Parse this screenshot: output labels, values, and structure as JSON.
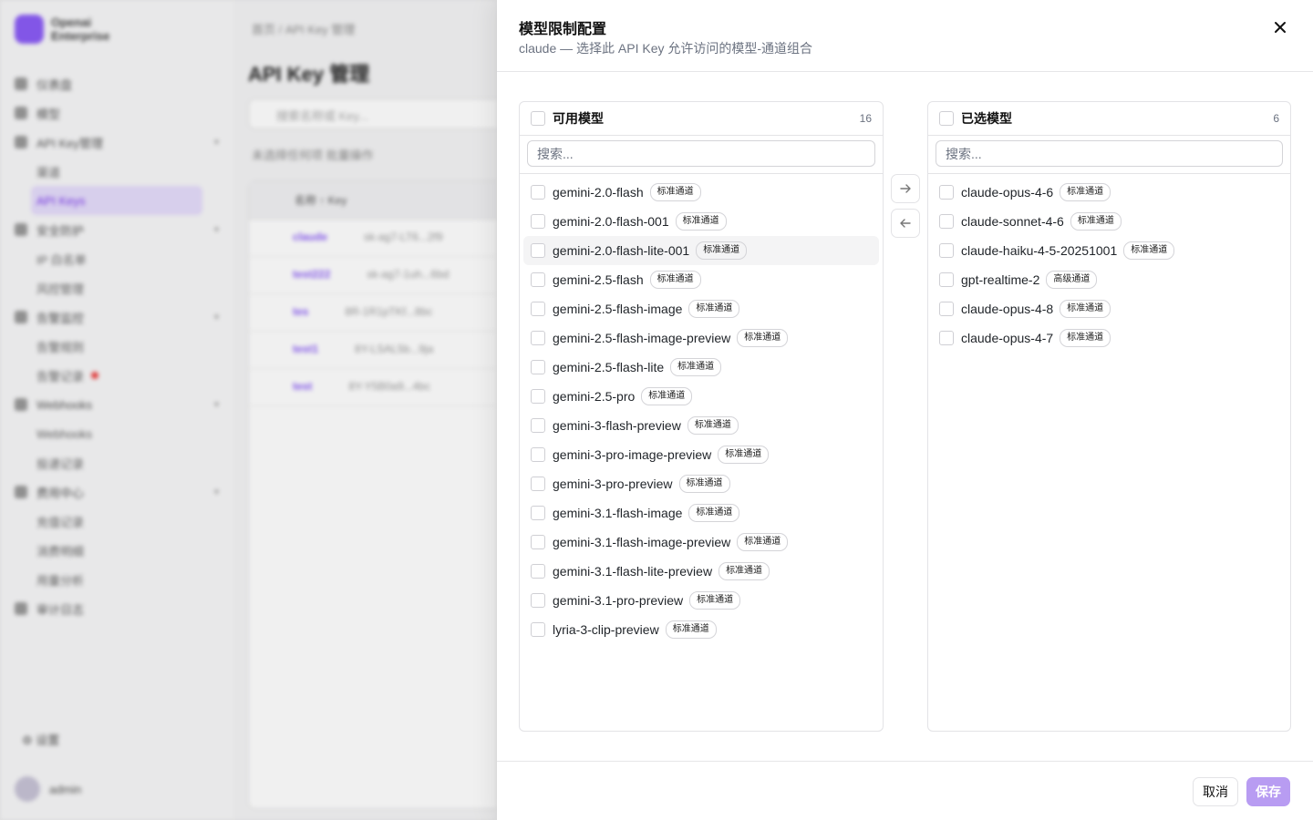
{
  "background": {
    "brand_line1": "Openai",
    "brand_line2": "Enterprise",
    "nav_items": [
      {
        "label": "仪表盘",
        "type": "top"
      },
      {
        "label": "模型",
        "type": "top"
      },
      {
        "label": "API Key管理",
        "type": "top",
        "chevron": true
      },
      {
        "label": "渠道",
        "type": "sub"
      },
      {
        "label": "API Keys",
        "type": "sub",
        "active": true
      },
      {
        "label": "安全防护",
        "type": "top",
        "chevron": true
      },
      {
        "label": "IP 白名单",
        "type": "sub"
      },
      {
        "label": "风控管理",
        "type": "sub"
      },
      {
        "label": "告警监控",
        "type": "top",
        "chevron": true
      },
      {
        "label": "告警规则",
        "type": "sub"
      },
      {
        "label": "告警记录",
        "type": "sub",
        "dot": true
      },
      {
        "label": "Webhooks",
        "type": "top",
        "chevron": true
      },
      {
        "label": "Webhooks",
        "type": "sub"
      },
      {
        "label": "投递记录",
        "type": "sub"
      },
      {
        "label": "费用中心",
        "type": "top",
        "chevron": true
      },
      {
        "label": "充值记录",
        "type": "sub"
      },
      {
        "label": "消费明细",
        "type": "sub"
      },
      {
        "label": "用量分析",
        "type": "sub"
      },
      {
        "label": "审计日志",
        "type": "top"
      }
    ],
    "settings_label": "设置",
    "user_name": "admin",
    "breadcrumb": "首页  /  API Key 管理",
    "page_title": "API Key 管理",
    "search_placeholder": "搜索名称或 Key...",
    "tabs": "未选择任何项    批量操作",
    "table_headers": "名称 ↑        Key",
    "rows": [
      {
        "name": "claude",
        "key": "sk-ag7-LT6...2f9"
      },
      {
        "name": "test222",
        "key": "sk-ag7-1uh...6bd"
      },
      {
        "name": "tes",
        "key": "8R-1R1pTKf...8bc"
      },
      {
        "name": "test1",
        "key": "8Y-LSAL5b...9ja"
      },
      {
        "name": "test",
        "key": "8Y-Y5B0a9...4bc"
      }
    ]
  },
  "drawer": {
    "title": "模型限制配置",
    "subtitle": "claude — 选择此 API Key 允许访问的模型-通道组合",
    "available": {
      "title": "可用模型",
      "count": "16",
      "search_placeholder": "搜索...",
      "items": [
        {
          "name": "gemini-2.0-flash",
          "channel": "标准通道"
        },
        {
          "name": "gemini-2.0-flash-001",
          "channel": "标准通道"
        },
        {
          "name": "gemini-2.0-flash-lite-001",
          "channel": "标准通道"
        },
        {
          "name": "gemini-2.5-flash",
          "channel": "标准通道"
        },
        {
          "name": "gemini-2.5-flash-image",
          "channel": "标准通道"
        },
        {
          "name": "gemini-2.5-flash-image-preview",
          "channel": "标准通道"
        },
        {
          "name": "gemini-2.5-flash-lite",
          "channel": "标准通道"
        },
        {
          "name": "gemini-2.5-pro",
          "channel": "标准通道"
        },
        {
          "name": "gemini-3-flash-preview",
          "channel": "标准通道"
        },
        {
          "name": "gemini-3-pro-image-preview",
          "channel": "标准通道"
        },
        {
          "name": "gemini-3-pro-preview",
          "channel": "标准通道"
        },
        {
          "name": "gemini-3.1-flash-image",
          "channel": "标准通道"
        },
        {
          "name": "gemini-3.1-flash-image-preview",
          "channel": "标准通道"
        },
        {
          "name": "gemini-3.1-flash-lite-preview",
          "channel": "标准通道"
        },
        {
          "name": "gemini-3.1-pro-preview",
          "channel": "标准通道"
        },
        {
          "name": "lyria-3-clip-preview",
          "channel": "标准通道"
        }
      ]
    },
    "selected": {
      "title": "已选模型",
      "count": "6",
      "search_placeholder": "搜索...",
      "items": [
        {
          "name": "claude-opus-4-6",
          "channel": "标准通道"
        },
        {
          "name": "claude-sonnet-4-6",
          "channel": "标准通道"
        },
        {
          "name": "claude-haiku-4-5-20251001",
          "channel": "标准通道"
        },
        {
          "name": "gpt-realtime-2",
          "channel": "高级通道"
        },
        {
          "name": "claude-opus-4-8",
          "channel": "标准通道"
        },
        {
          "name": "claude-opus-4-7",
          "channel": "标准通道"
        }
      ]
    },
    "cancel_label": "取消",
    "save_label": "保存",
    "accent_color": "#b89cf2"
  }
}
